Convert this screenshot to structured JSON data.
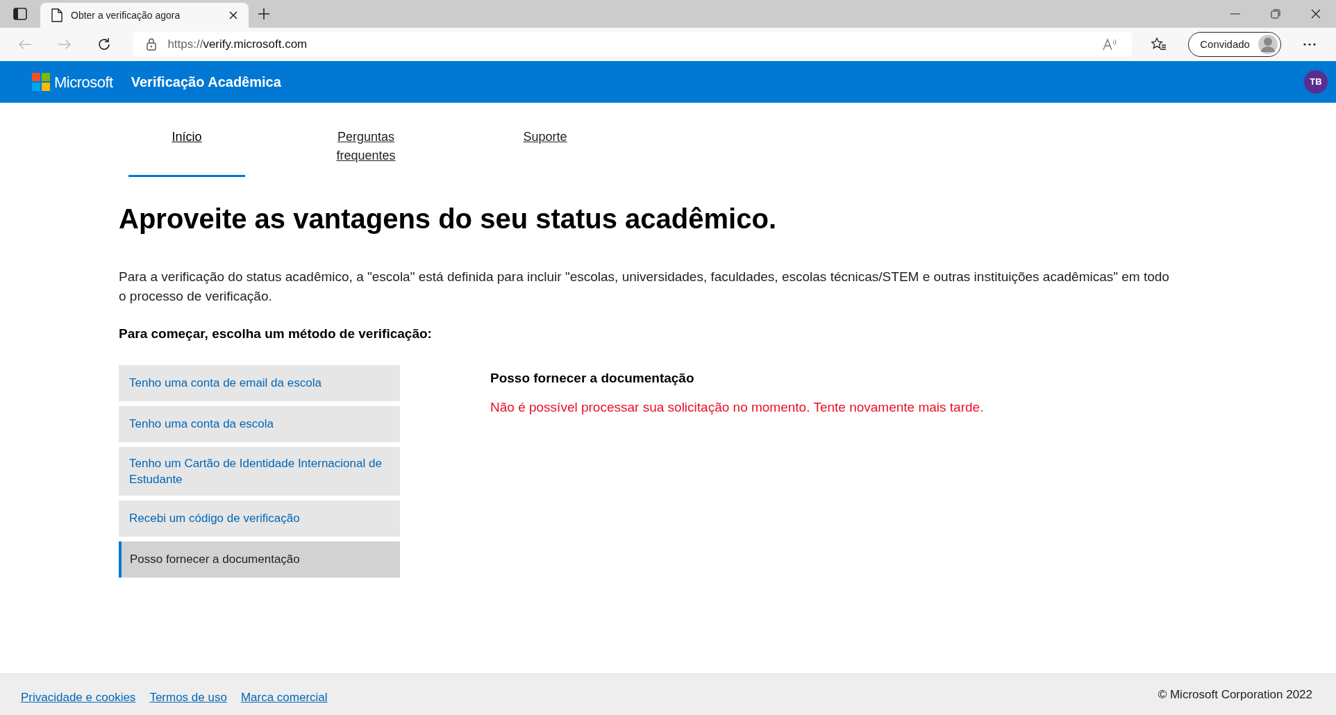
{
  "browser": {
    "tab_title": "Obter a verificação agora",
    "url_scheme": "https://",
    "url_host": "verify.microsoft.com",
    "profile": "Convidado"
  },
  "header": {
    "brand": "Microsoft",
    "title": "Verificação Acadêmica",
    "avatar": "TB"
  },
  "tabs": [
    {
      "label": "Início",
      "selected": true
    },
    {
      "label": "Perguntas frequentes",
      "selected": false
    },
    {
      "label": "Suporte",
      "selected": false
    }
  ],
  "heading": "Aproveite as vantagens do seu status acadêmico.",
  "intro": "Para a verificação do status acadêmico, a \"escola\" está definida para incluir \"escolas, universidades, faculdades, escolas técnicas/STEM e outras instituições acadêmicas\" em todo o processo de verificação.",
  "methods_heading": "Para começar, escolha um método de verificação:",
  "methods": [
    {
      "label": "Tenho uma conta de email da escola",
      "selected": false
    },
    {
      "label": "Tenho uma conta da escola",
      "selected": false
    },
    {
      "label": "Tenho um Cartão de Identidade Internacional de Estudante",
      "selected": false
    },
    {
      "label": "Recebi um código de verificação",
      "selected": false
    },
    {
      "label": "Posso fornecer a documentação",
      "selected": true
    }
  ],
  "panel": {
    "title": "Posso fornecer a documentação",
    "error": "Não é possível processar sua solicitação no momento. Tente novamente mais tarde."
  },
  "footer": {
    "links": [
      "Privacidade e cookies",
      "Termos de uso",
      "Marca comercial"
    ],
    "copyright": "© Microsoft Corporation 2022"
  }
}
